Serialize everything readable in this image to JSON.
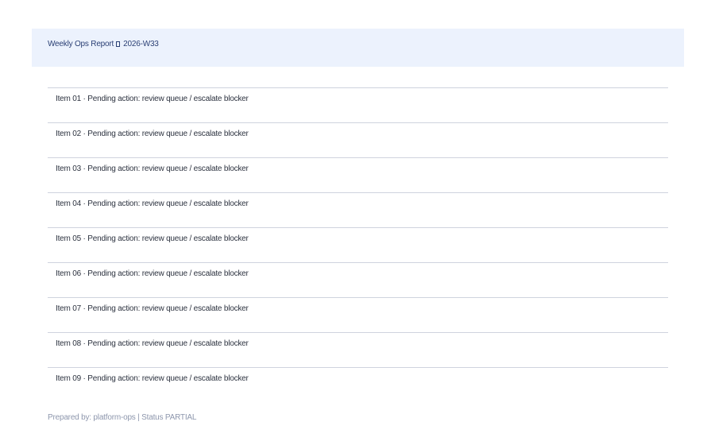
{
  "header": {
    "title_prefix": "Weekly Ops Report",
    "separator_icon": "box-glyph",
    "title_suffix": "2026-W33"
  },
  "items": [
    {
      "label": "Item 01",
      "separator": "·",
      "text": "Pending action: review queue / escalate blocker"
    },
    {
      "label": "Item 02",
      "separator": "·",
      "text": "Pending action: review queue / escalate blocker"
    },
    {
      "label": "Item 03",
      "separator": "·",
      "text": "Pending action: review queue / escalate blocker"
    },
    {
      "label": "Item 04",
      "separator": "·",
      "text": "Pending action: review queue / escalate blocker"
    },
    {
      "label": "Item 05",
      "separator": "·",
      "text": "Pending action: review queue / escalate blocker"
    },
    {
      "label": "Item 06",
      "separator": "·",
      "text": "Pending action: review queue / escalate blocker"
    },
    {
      "label": "Item 07",
      "separator": "·",
      "text": "Pending action: review queue / escalate blocker"
    },
    {
      "label": "Item 08",
      "separator": "·",
      "text": "Pending action: review queue / escalate blocker"
    },
    {
      "label": "Item 09",
      "separator": "·",
      "text": "Pending action: review queue / escalate blocker"
    }
  ],
  "footer": {
    "text": "Prepared by: platform-ops | Status PARTIAL"
  },
  "colors": {
    "header_band": "#ecf2fd",
    "header_text": "#2a3f74",
    "item_text": "#2d3340",
    "divider": "#cfd3de",
    "footer_text": "#8e97ad"
  }
}
